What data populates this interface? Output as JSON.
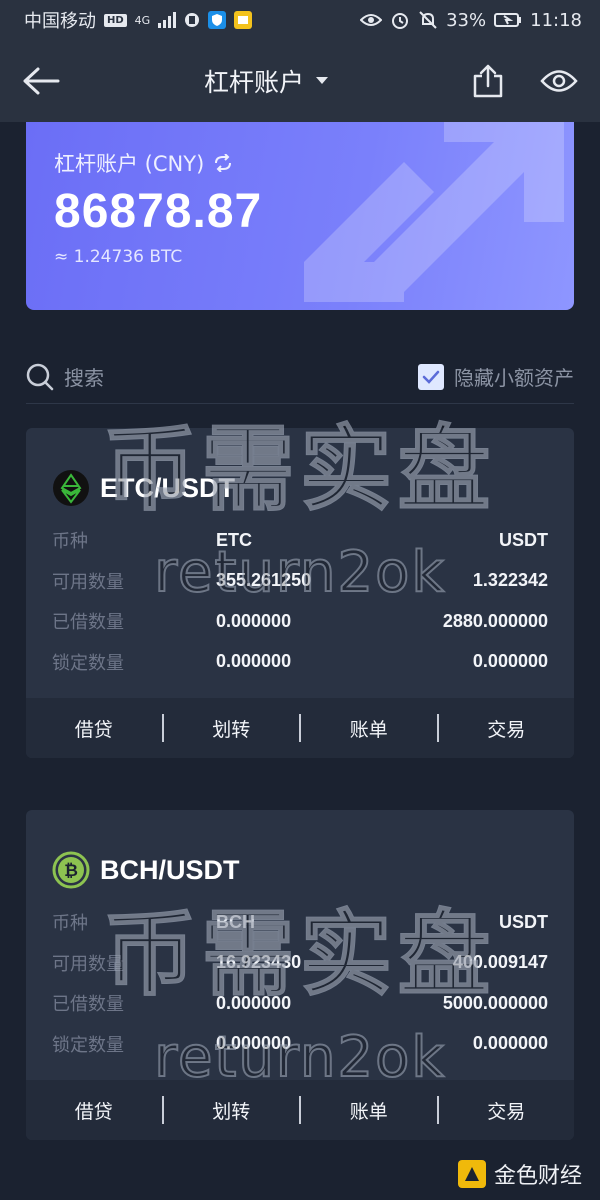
{
  "status": {
    "carrier": "中国移动",
    "net_badge": "HD",
    "net_type": "4G",
    "battery": "33%",
    "time": "11:18"
  },
  "header": {
    "title": "杠杆账户"
  },
  "balance": {
    "label": "杠杆账户 (CNY)",
    "amount": "86878.87",
    "btc": "≈ 1.24736 BTC"
  },
  "search": {
    "placeholder": "搜索",
    "hide_small_label": "隐藏小额资产",
    "hide_small_checked": true
  },
  "pairs": [
    {
      "name": "ETC/USDT",
      "icon": "etc-icon",
      "icon_color": "#3ab83a",
      "cols": [
        "币种",
        "ETC",
        "USDT"
      ],
      "rows": [
        {
          "label": "可用数量",
          "a": "355.261250",
          "b": "1.322342"
        },
        {
          "label": "已借数量",
          "a": "0.000000",
          "b": "2880.000000"
        },
        {
          "label": "锁定数量",
          "a": "0.000000",
          "b": "0.000000"
        }
      ],
      "actions": [
        "借贷",
        "划转",
        "账单",
        "交易"
      ]
    },
    {
      "name": "BCH/USDT",
      "icon": "bch-icon",
      "icon_color": "#8dc351",
      "cols": [
        "币种",
        "BCH",
        "USDT"
      ],
      "rows": [
        {
          "label": "可用数量",
          "a": "16.923430",
          "b": "400.009147"
        },
        {
          "label": "已借数量",
          "a": "0.000000",
          "b": "5000.000000"
        },
        {
          "label": "锁定数量",
          "a": "0.000000",
          "b": "0.000000"
        }
      ],
      "actions": [
        "借贷",
        "划转",
        "账单",
        "交易"
      ]
    }
  ],
  "watermark": {
    "cn": "币需实盘",
    "en": "return2ok"
  },
  "footer": {
    "brand": "金色财经"
  },
  "colors": {
    "accent": "#6b6ef6",
    "bg": "#1b2230",
    "card": "#2a3344"
  }
}
